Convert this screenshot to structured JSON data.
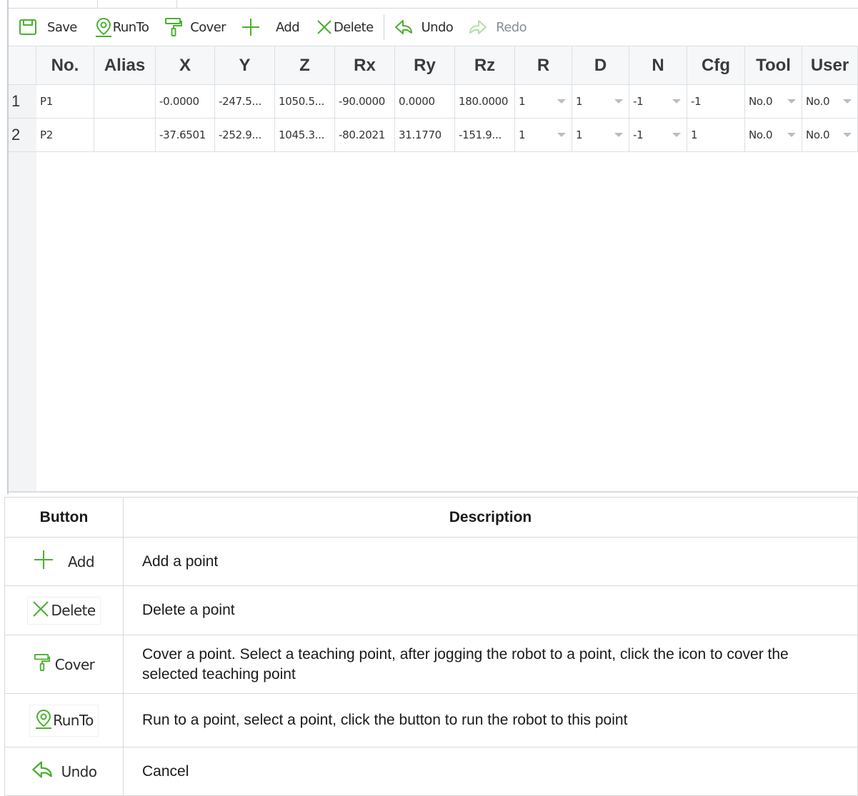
{
  "toolbar": {
    "save": "Save",
    "runto": "RunTo",
    "cover": "Cover",
    "add": "Add",
    "delete": "Delete",
    "undo": "Undo",
    "redo": "Redo"
  },
  "grid": {
    "columns": [
      "No.",
      "Alias",
      "X",
      "Y",
      "Z",
      "Rx",
      "Ry",
      "Rz",
      "R",
      "D",
      "N",
      "Cfg",
      "Tool",
      "User"
    ],
    "rows": [
      {
        "index": "1",
        "no": "P1",
        "alias": "",
        "x": "-0.0000",
        "y": "-247.5...",
        "z": "1050.5...",
        "rx": "-90.0000",
        "ry": "0.0000",
        "rz": "180.0000",
        "r": "1",
        "d": "1",
        "n": "-1",
        "cfg": "-1",
        "tool": "No.0",
        "user": "No.0"
      },
      {
        "index": "2",
        "no": "P2",
        "alias": "",
        "x": "-37.6501",
        "y": "-252.9...",
        "z": "1045.3...",
        "rx": "-80.2021",
        "ry": "31.1770",
        "rz": "-151.9...",
        "r": "1",
        "d": "1",
        "n": "-1",
        "cfg": "1",
        "tool": "No.0",
        "user": "No.0"
      }
    ]
  },
  "doc_table": {
    "header_button": "Button",
    "header_description": "Description",
    "rows": [
      {
        "button": "Add",
        "description": "Add a point"
      },
      {
        "button": "Delete",
        "description": "Delete a point"
      },
      {
        "button": "Cover",
        "description": "Cover a point. Select a teaching point, after jogging the robot to a point, click the icon to cover the selected teaching point"
      },
      {
        "button": "RunTo",
        "description": "Run to a point, select a point, click the button to run the robot to this point"
      },
      {
        "button": "Undo",
        "description": "Cancel"
      }
    ]
  },
  "colors": {
    "icon_green": "#4caf2f",
    "disabled_gray": "#8a8f96"
  },
  "icons": [
    "save-icon",
    "location-pin-icon",
    "paint-roller-icon",
    "plus-icon",
    "x-icon",
    "undo-arrow-icon",
    "redo-arrow-icon",
    "dropdown-arrow-icon"
  ]
}
